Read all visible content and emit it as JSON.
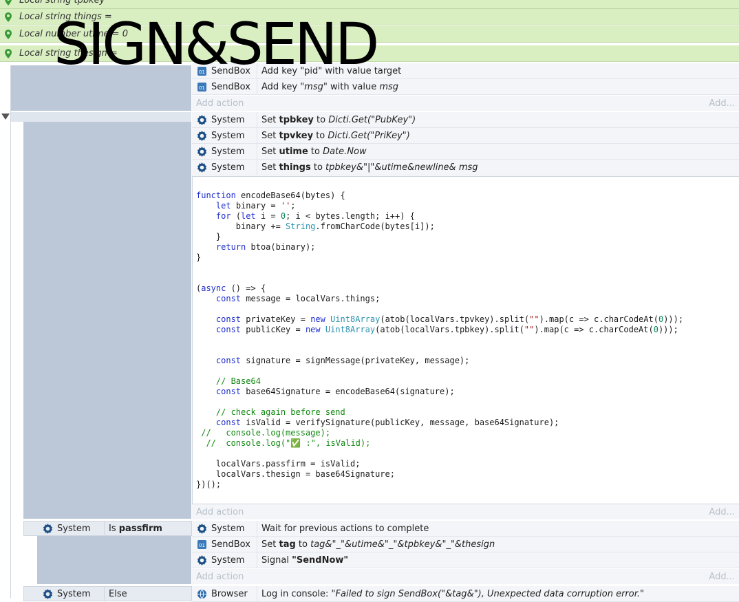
{
  "overlay_title": "SIGN&SEND",
  "global_vars": [
    {
      "label": "Local string tpbkey"
    },
    {
      "label": "Local string things ="
    },
    {
      "label": "Local number utime = 0"
    },
    {
      "label": "Local string thesign ="
    }
  ],
  "group1": {
    "rows": [
      {
        "object": "SendBox",
        "action": "Add key \"pid\" with value target"
      },
      {
        "object": "SendBox",
        "action": "Add key \"msg\" with value msg"
      }
    ],
    "add_action": "Add action",
    "add_right": "Add..."
  },
  "group2": {
    "rows": [
      {
        "object": "System",
        "pre": "Set ",
        "var": "tpbkey",
        "mid": " to ",
        "expr": "Dicti.Get(\"PubKey\")"
      },
      {
        "object": "System",
        "pre": "Set ",
        "var": "tpvkey",
        "mid": " to ",
        "expr": "Dicti.Get(\"PriKey\")"
      },
      {
        "object": "System",
        "pre": "Set ",
        "var": "utime",
        "mid": " to ",
        "expr": "Date.Now"
      },
      {
        "object": "System",
        "pre": "Set ",
        "var": "things",
        "mid": " to ",
        "expr": "tpbkey&\"|\"&utime&newline& msg"
      }
    ],
    "add_action": "Add action",
    "add_right": "Add..."
  },
  "code_lines": [
    "function encodeBase64(bytes) {",
    "    let binary = '';",
    "    for (let i = 0; i < bytes.length; i++) {",
    "        binary += String.fromCharCode(bytes[i]);",
    "    }",
    "    return btoa(binary);",
    "}",
    "",
    "",
    "(async () => {",
    "    const message = localVars.things;",
    "",
    "    const privateKey = new Uint8Array(atob(localVars.tpvkey).split(\"\").map(c => c.charCodeAt(0)));",
    "    const publicKey = new Uint8Array(atob(localVars.tpbkey).split(\"\").map(c => c.charCodeAt(0)));",
    "",
    "",
    "    const signature = signMessage(privateKey, message);",
    "",
    "    // Base64",
    "    const base64Signature = encodeBase64(signature);",
    "",
    "    // check again before send",
    "    const isValid = verifySignature(publicKey, message, base64Signature);",
    " //   console.log(message);",
    "  //  console.log(\"✅ :\", isValid);",
    "",
    "    localVars.passfirm = isValid;",
    "    localVars.thesign = base64Signature;",
    "})();"
  ],
  "group3": {
    "event_object": "System",
    "event_condition_pre": "Is ",
    "event_condition_var": "passfirm",
    "rows": [
      {
        "object": "System",
        "action": "Wait for previous actions to complete"
      },
      {
        "object": "SendBox",
        "pre": "Set ",
        "var": "tag",
        "mid": " to ",
        "expr": "tag&\"_\"&utime&\"_\"&tpbkey&\"_\"&thesign"
      },
      {
        "object": "System",
        "pre": "Signal ",
        "var": "\"SendNow\"",
        "mid": "",
        "expr": ""
      }
    ],
    "add_action": "Add action",
    "add_right": "Add..."
  },
  "group4": {
    "event_object": "System",
    "event_condition": "Else",
    "row": {
      "object": "Browser",
      "pre": "Log in console: ",
      "expr": "\"Failed to sign SendBox(\"&tag&\"), Unexpected data corruption error.\""
    }
  }
}
